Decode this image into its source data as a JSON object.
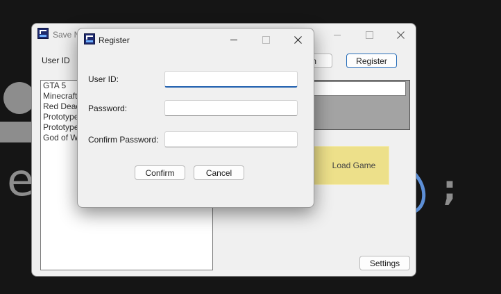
{
  "main_window": {
    "title": "Save N",
    "user_id_label": "User ID",
    "partial_button_label": "n",
    "register_button": "Register",
    "games": [
      "GTA 5",
      "Minecraft",
      "Red Dead",
      "Prototype",
      "Prototype",
      "God of W"
    ],
    "load_game_button": "Load Game",
    "settings_button": "Settings"
  },
  "dialog": {
    "title": "Register",
    "user_id_label": "User ID:",
    "password_label": "Password:",
    "confirm_password_label": "Confirm Password:",
    "user_id_value": "",
    "password_value": "",
    "confirm_password_value": "",
    "confirm_button": "Confirm",
    "cancel_button": "Cancel"
  },
  "background_text": {
    "letter": "e",
    "semicolon": ";"
  },
  "colors": {
    "load_game_bg": "#ede08a",
    "accent_focus": "#1f5fae",
    "register_border": "#2a6fba",
    "desktop_bg": "#151515"
  },
  "icons": [
    "app-icon",
    "minimize-icon",
    "maximize-icon",
    "close-icon"
  ]
}
